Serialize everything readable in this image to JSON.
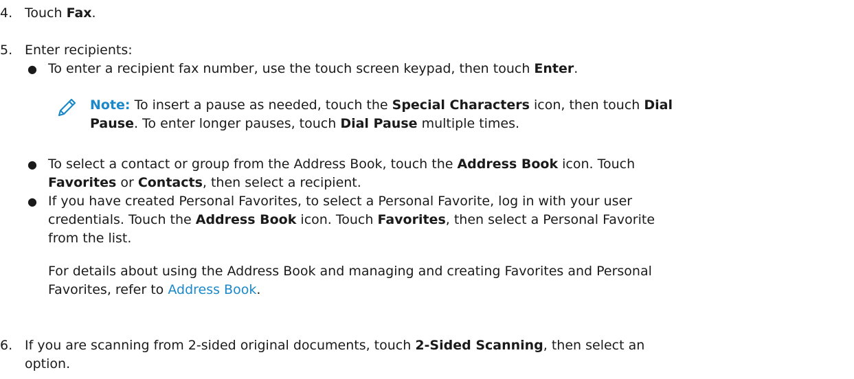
{
  "steps": [
    {
      "num": "4.",
      "pre": "Touch ",
      "bold": "Fax",
      "post": "."
    },
    {
      "num": "5.",
      "text": "Enter recipients:",
      "bullets": [
        {
          "t1": "To enter a recipient fax number, use the touch screen keypad, then touch ",
          "b1": "Enter",
          "t2": "."
        },
        {
          "line1_t1": "To select a contact or group from the Address Book, touch the ",
          "line1_b1": "Address Book",
          "line1_t2": " icon. Touch",
          "line2_b1": "Favorites",
          "line2_t1": " or ",
          "line2_b2": "Contacts",
          "line2_t2": ", then select a recipient."
        },
        {
          "line1": "If you have created Personal Favorites, to select a Personal Favorite, log in with your user",
          "line2_t1": "credentials. Touch the ",
          "line2_b1": "Address Book",
          "line2_t2": " icon. Touch ",
          "line2_b2": "Favorites",
          "line2_t3": ", then select a Personal Favorite",
          "line3": "from the list."
        }
      ],
      "note": {
        "icon": "pencil-icon",
        "label": "Note:",
        "l1_t1": " To insert a pause as needed, touch the ",
        "l1_b1": "Special Characters",
        "l1_t2": " icon, then touch ",
        "l1_b2": "Dial",
        "l2_b1": "Pause",
        "l2_t1": ". To enter longer pauses, touch ",
        "l2_b2": "Dial Pause",
        "l2_t2": " multiple times."
      },
      "details": {
        "line1": "For details about using the Address Book and managing and creating Favorites and Personal",
        "line2_t1": "Favorites, refer to ",
        "line2_link": "Address Book",
        "line2_t2": "."
      }
    },
    {
      "num": "6.",
      "line1_t1": "If you are scanning from 2-sided original documents, touch ",
      "line1_b1": "2-Sided Scanning",
      "line1_t2": ", then select an",
      "line2": "option."
    }
  ],
  "colors": {
    "accent": "#1a88c9",
    "text": "#1a1a1a"
  }
}
